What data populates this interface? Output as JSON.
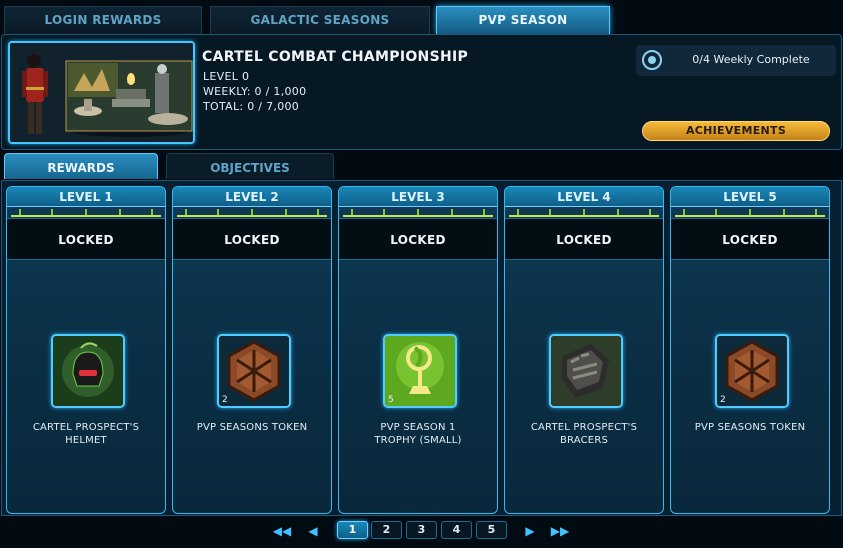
{
  "top_tabs": [
    {
      "label": "LOGIN REWARDS",
      "active": false
    },
    {
      "label": "GALACTIC SEASONS",
      "active": false
    },
    {
      "label": "PVP SEASON",
      "active": true
    }
  ],
  "header": {
    "title": "CARTEL COMBAT CHAMPIONSHIP",
    "level": "LEVEL 0",
    "weekly": "WEEKLY: 0 / 1,000",
    "total": "TOTAL: 0 / 7,000",
    "weekly_complete": "0/4 Weekly Complete",
    "achievements_label": "ACHIEVEMENTS",
    "image_icon": "season-banner-icon"
  },
  "sub_tabs": [
    {
      "label": "REWARDS",
      "active": true
    },
    {
      "label": "OBJECTIVES",
      "active": false
    }
  ],
  "levels": [
    {
      "label": "LEVEL 1",
      "status": "LOCKED",
      "reward_line1": "CARTEL PROSPECT'S",
      "reward_line2": "HELMET",
      "count": "",
      "icon": "helmet-icon"
    },
    {
      "label": "LEVEL 2",
      "status": "LOCKED",
      "reward_line1": "PVP SEASONS TOKEN",
      "reward_line2": "",
      "count": "2",
      "icon": "token-icon"
    },
    {
      "label": "LEVEL 3",
      "status": "LOCKED",
      "reward_line1": "PVP SEASON 1",
      "reward_line2": "TROPHY (SMALL)",
      "count": "5",
      "icon": "trophy-icon"
    },
    {
      "label": "LEVEL 4",
      "status": "LOCKED",
      "reward_line1": "CARTEL PROSPECT'S",
      "reward_line2": "BRACERS",
      "count": "",
      "icon": "bracers-icon"
    },
    {
      "label": "LEVEL 5",
      "status": "LOCKED",
      "reward_line1": "PVP SEASONS TOKEN",
      "reward_line2": "",
      "count": "2",
      "icon": "token-icon"
    }
  ],
  "pagination": {
    "pages": [
      "1",
      "2",
      "3",
      "4",
      "5"
    ],
    "current": "1",
    "first_icon": "first-page-icon",
    "prev_icon": "previous-page-icon",
    "next_icon": "next-page-icon",
    "last_icon": "last-page-icon"
  },
  "colors": {
    "accent": "#2aa6e6",
    "achievement_gold": "#f0b030",
    "progress_green": "#c6e64e",
    "background": "#020a12"
  }
}
